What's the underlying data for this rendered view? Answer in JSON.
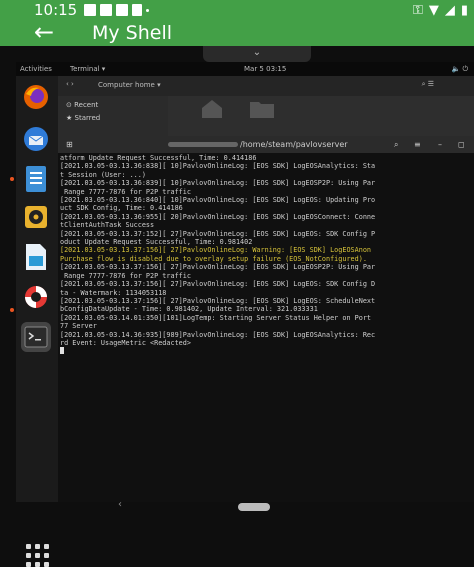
{
  "status_bar": {
    "time": "10:15",
    "icons": [
      "notification-icon",
      "gallery-icon",
      "photo-icon",
      "android-icon",
      "dot-icon"
    ],
    "right_icons": [
      "vpn-key-icon",
      "wifi-icon",
      "signal-icon",
      "battery-icon"
    ]
  },
  "app_bar": {
    "back_glyph": "←",
    "title": "My Shell"
  },
  "vnc_toggle": "⌄",
  "desktop_topbar": {
    "activities": "Activities",
    "terminal_menu": "Terminal ▾",
    "clock": "Mar 5 03:15",
    "tray": "🔈 ⏻"
  },
  "dock": {
    "items": [
      {
        "name": "firefox",
        "color": "#e66000"
      },
      {
        "name": "thunderbird",
        "color": "#2f7bd8"
      },
      {
        "name": "files",
        "color": "#3d8fd6"
      },
      {
        "name": "rhythmbox",
        "color": "#e9b22e"
      },
      {
        "name": "writer",
        "color": "#2a9ad6"
      },
      {
        "name": "help",
        "color": "#e53935"
      },
      {
        "name": "terminal",
        "color": "#333333"
      }
    ],
    "show_apps": "Show Applications"
  },
  "nautilus": {
    "location": "Computer  home ▾",
    "sidebar": [
      "⊙ Recent",
      "★ Starred"
    ]
  },
  "terminal": {
    "title": "/home/steam/pavlovserver",
    "lines": [
      {
        "text": "atform Update Request Successful, Time: 0.414186",
        "warn": false
      },
      {
        "text": "[2021.03.05-03.13.36:838][ 10]PavlovOnlineLog: [EOS SDK] LogEOSAnalytics: Sta",
        "warn": false
      },
      {
        "text": "t Session (User: ...)",
        "warn": false
      },
      {
        "text": "[2021.03.05-03.13.36:839][ 10]PavlovOnlineLog: [EOS SDK] LogEOSP2P: Using Par",
        "warn": false
      },
      {
        "text": " Range 7777-7876 for P2P traffic",
        "warn": false
      },
      {
        "text": "[2021.03.05-03.13.36:840][ 10]PavlovOnlineLog: [EOS SDK] LogEOS: Updating Pro",
        "warn": false
      },
      {
        "text": "uct SDK Config, Time: 0.414186",
        "warn": false
      },
      {
        "text": "[2021.03.05-03.13.36:955][ 20]PavlovOnlineLog: [EOS SDK] LogEOSConnect: Conne",
        "warn": false
      },
      {
        "text": "tClientAuthTask Success",
        "warn": false
      },
      {
        "text": "[2021.03.05-03.13.37:152][ 27]PavlovOnlineLog: [EOS SDK] LogEOS: SDK Config P",
        "warn": false
      },
      {
        "text": "oduct Update Request Successful, Time: 0.981402",
        "warn": false
      },
      {
        "text": "[2021.03.05-03.13.37:156][ 27]PavlovOnlineLog: Warning: [EOS SDK] LogEOSAnon",
        "warn": true
      },
      {
        "text": "Purchase flow is disabled due to overlay setup failure (EOS_NotConfigured).",
        "warn": true
      },
      {
        "text": "[2021.03.05-03.13.37:156][ 27]PavlovOnlineLog: [EOS SDK] LogEOSP2P: Using Par",
        "warn": false
      },
      {
        "text": " Range 7777-7876 for P2P traffic",
        "warn": false
      },
      {
        "text": "[2021.03.05-03.13.37:156][ 27]PavlovOnlineLog: [EOS SDK] LogEOS: SDK Config D",
        "warn": false
      },
      {
        "text": "ta - Watermark: 1134053118",
        "warn": false
      },
      {
        "text": "[2021.03.05-03.13.37:156][ 27]PavlovOnlineLog: [EOS SDK] LogEOS: ScheduleNext",
        "warn": false
      },
      {
        "text": "bConfigDataUpdate - Time: 0.981402, Update Interval: 321.033331",
        "warn": false
      },
      {
        "text": "[2021.03.05-03.14.01:350][101]LogTemp: Starting Server Status Helper on Port",
        "warn": false
      },
      {
        "text": "77 Server",
        "warn": false
      },
      {
        "text": "[2021.03.05-03.14.36:935][989]PavlovOnlineLog: [EOS SDK] LogEOSAnalytics: Rec",
        "warn": false
      },
      {
        "text": "rd Event: UsageMetric <Redacted>",
        "warn": false
      }
    ]
  },
  "nav": {
    "back": "‹"
  }
}
